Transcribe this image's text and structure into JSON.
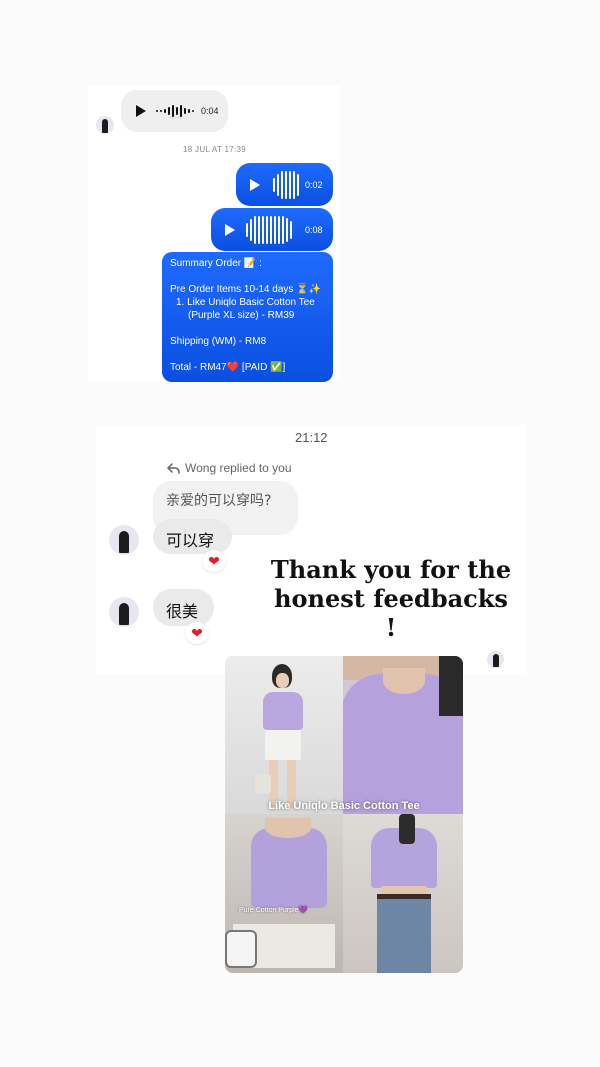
{
  "chat1": {
    "incoming_voice": {
      "duration": "0:04"
    },
    "timestamp": "18 JUL AT 17:39",
    "outgoing_voice": [
      {
        "duration": "0:02"
      },
      {
        "duration": "0:08"
      }
    ],
    "summary": {
      "title": "Summary Order 📝 :",
      "items_header": "Pre Order Items 10-14 days ⏳✨",
      "item_line1": "1.  Like Uniqlo Basic Cotton Tee",
      "item_line2": "(Purple XL size) - RM39",
      "shipping": "Shipping (WM) - RM8",
      "total": "Total - RM47❤️ [PAID ✅]"
    }
  },
  "chat2": {
    "time": "21:12",
    "reply_label": "Wong replied to you",
    "quoted_message": "亲爱的可以穿吗?",
    "messages": [
      {
        "text": "可以穿",
        "reaction": "❤"
      },
      {
        "text": "很美",
        "reaction": "❤"
      }
    ]
  },
  "overlay": {
    "thanks_line1": "Thank you for the",
    "thanks_line2": "honest feedbacks !"
  },
  "product": {
    "title": "Like Uniqlo Basic Cotton Tee",
    "color_label": "Pure Cotton Purple💜"
  },
  "colors": {
    "messenger_blue": "#0a4fe0",
    "lavender": "#b9a7df",
    "heart_red": "#e0202c"
  }
}
